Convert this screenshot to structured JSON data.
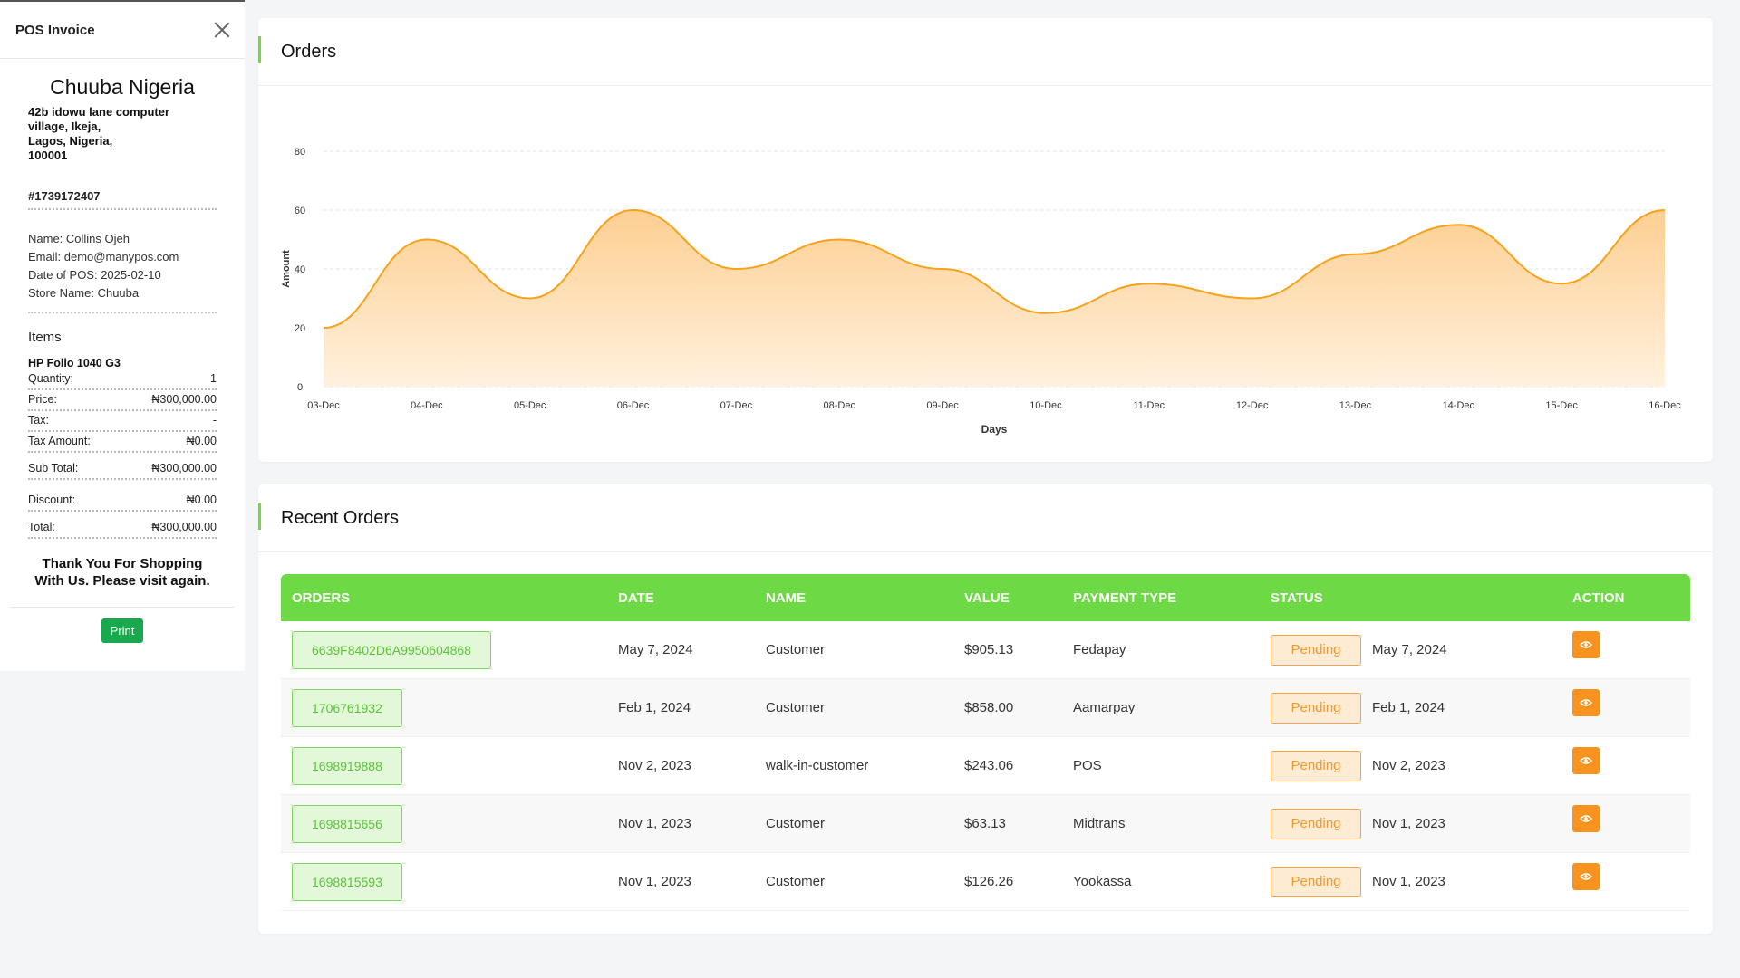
{
  "invoice": {
    "title": "POS Invoice",
    "store_name": "Chuuba Nigeria",
    "address_line1": "42b idowu lane computer village, Ikeja,",
    "address_line2": "Lagos, Nigeria,",
    "address_line3": "100001",
    "invoice_no": "#1739172407",
    "customer_name": "Name: Collins Ojeh",
    "customer_email": "Email: demo@manypos.com",
    "pos_date": "Date of POS: 2025-02-10",
    "store_label": "Store Name: Chuuba",
    "items_title": "Items",
    "item_name": "HP Folio 1040 G3",
    "rows": [
      {
        "label": "Quantity:",
        "value": "1"
      },
      {
        "label": "Price:",
        "value": "₦300,000.00"
      },
      {
        "label": "Tax:",
        "value": "-"
      },
      {
        "label": "Tax Amount:",
        "value": "₦0.00"
      }
    ],
    "subtotal": {
      "label": "Sub Total:",
      "value": "₦300,000.00"
    },
    "discount": {
      "label": "Discount:",
      "value": "₦0.00"
    },
    "total": {
      "label": "Total:",
      "value": "₦300,000.00"
    },
    "thanks": "Thank You For Shopping With Us. Please visit again.",
    "print_label": "Print"
  },
  "orders_card": {
    "title": "Orders"
  },
  "chart_data": {
    "type": "area",
    "title": "",
    "xlabel": "Days",
    "ylabel": "Amount",
    "ylim": [
      0,
      80
    ],
    "yticks": [
      0,
      20,
      40,
      60,
      80
    ],
    "categories": [
      "03-Dec",
      "04-Dec",
      "05-Dec",
      "06-Dec",
      "07-Dec",
      "08-Dec",
      "09-Dec",
      "10-Dec",
      "11-Dec",
      "12-Dec",
      "13-Dec",
      "14-Dec",
      "15-Dec",
      "16-Dec"
    ],
    "values": [
      20,
      50,
      30,
      60,
      40,
      50,
      40,
      25,
      35,
      30,
      45,
      55,
      35,
      60
    ],
    "grid": true,
    "line_color": "#f7a21b",
    "fill_top": "#fdcf92",
    "fill_bottom": "#fff1de"
  },
  "recent": {
    "title": "Recent Orders",
    "headers": [
      "ORDERS",
      "DATE",
      "NAME",
      "VALUE",
      "PAYMENT TYPE",
      "STATUS",
      "ACTION"
    ],
    "rows": [
      {
        "order": "6639F8402D6A9950604868",
        "date": "May 7, 2024",
        "name": "Customer",
        "value": "$905.13",
        "payment": "Fedapay",
        "status": "Pending",
        "status_date": "May 7, 2024"
      },
      {
        "order": "1706761932",
        "date": "Feb 1, 2024",
        "name": "Customer",
        "value": "$858.00",
        "payment": "Aamarpay",
        "status": "Pending",
        "status_date": "Feb 1, 2024"
      },
      {
        "order": "1698919888",
        "date": "Nov 2, 2023",
        "name": "walk-in-customer",
        "value": "$243.06",
        "payment": "POS",
        "status": "Pending",
        "status_date": "Nov 2, 2023"
      },
      {
        "order": "1698815656",
        "date": "Nov 1, 2023",
        "name": "Customer",
        "value": "$63.13",
        "payment": "Midtrans",
        "status": "Pending",
        "status_date": "Nov 1, 2023"
      },
      {
        "order": "1698815593",
        "date": "Nov 1, 2023",
        "name": "Customer",
        "value": "$126.26",
        "payment": "Yookassa",
        "status": "Pending",
        "status_date": "Nov 1, 2023"
      }
    ],
    "action_icon": "eye-icon"
  },
  "colors": {
    "accent_green": "#6dd944",
    "print_green": "#18a94e",
    "pending_orange": "#f7931e"
  }
}
